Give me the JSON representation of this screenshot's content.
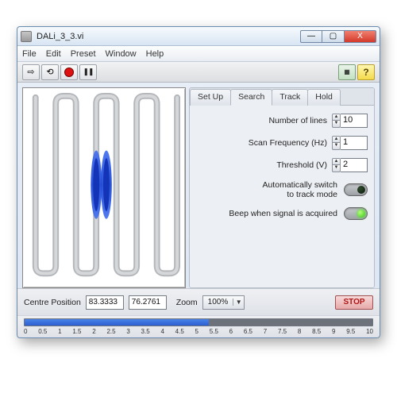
{
  "window": {
    "title": "DALi_3_3.vi",
    "buttons": {
      "min": "—",
      "max": "▢",
      "close": "X"
    }
  },
  "menu": [
    "File",
    "Edit",
    "Preset",
    "Window",
    "Help"
  ],
  "toolbar": {
    "run": "⇨",
    "loop": "⟲",
    "record": "",
    "pause": "",
    "help": "?"
  },
  "tabs": [
    {
      "label": "Set Up",
      "active": false
    },
    {
      "label": "Search",
      "active": true
    },
    {
      "label": "Track",
      "active": false
    },
    {
      "label": "Hold",
      "active": false
    }
  ],
  "search": {
    "lines_label": "Number of lines",
    "lines_value": "10",
    "freq_label": "Scan Frequency (Hz)",
    "freq_value": "1",
    "thresh_label": "Threshold (V)",
    "thresh_value": "2",
    "auto_label": "Automatically switch\nto track mode",
    "auto_on": false,
    "beep_label": "Beep when signal is acquired",
    "beep_on": true
  },
  "status": {
    "centre_label": "Centre Position",
    "x": "83.3333",
    "y": "76.2761",
    "zoom_label": "Zoom",
    "zoom_value": "100%",
    "stop": "STOP"
  },
  "scale": {
    "blue_frac": 0.53,
    "dark_frac": 0.47,
    "ticks": [
      "0",
      "0.5",
      "1",
      "1.5",
      "2",
      "2.5",
      "3",
      "3.5",
      "4",
      "4.5",
      "5",
      "5.5",
      "6",
      "6.5",
      "7",
      "7.5",
      "8",
      "8.5",
      "9",
      "9.5",
      "10"
    ]
  },
  "colors": {
    "accent_blue": "#2c5fd0",
    "stop_red": "#b01515",
    "led_on": "#36c518"
  }
}
